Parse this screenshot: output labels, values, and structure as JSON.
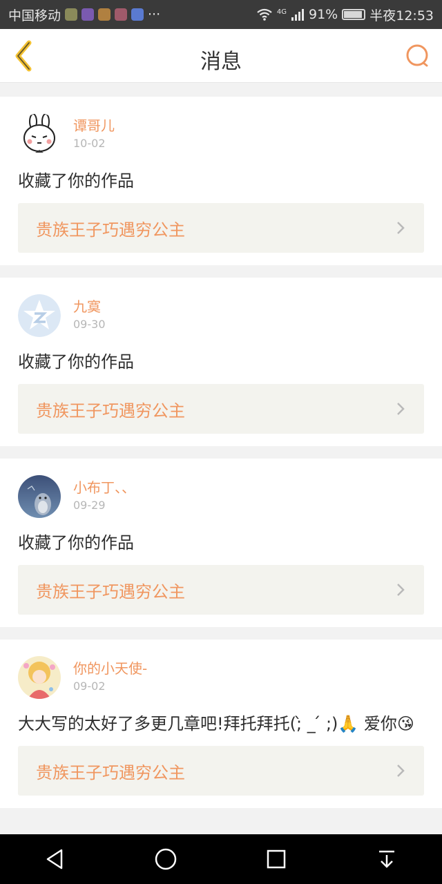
{
  "status_bar": {
    "carrier": "中国移动",
    "overflow": "···",
    "network": "4G",
    "battery": "91%",
    "battery_level": 0.91,
    "time": "半夜12:53"
  },
  "header": {
    "title": "消息",
    "back_icon": "back-chevron-icon",
    "search_icon": "search-icon"
  },
  "colors": {
    "accent": "#f0965f",
    "link_bg": "#f3f3ee",
    "page_bg": "#f2f2f2"
  },
  "messages": [
    {
      "username": "谭哥儿",
      "date": "10-02",
      "text": "收藏了你的作品",
      "work_title": "贵族王子巧遇穷公主"
    },
    {
      "username": "九寞",
      "date": "09-30",
      "text": "收藏了你的作品",
      "work_title": "贵族王子巧遇穷公主"
    },
    {
      "username": "小布丁、、",
      "date": "09-29",
      "text": "收藏了你的作品",
      "work_title": "贵族王子巧遇穷公主"
    },
    {
      "username": "你的小天使-",
      "date": "09-02",
      "text": "大大写的太好了多更几章吧!拜托拜托(;̀ _ ́ ;)🙏 爱你😘",
      "work_title": "贵族王子巧遇穷公主"
    }
  ],
  "nav_bar": {
    "back_icon": "nav-back-icon",
    "home_icon": "nav-home-icon",
    "recents_icon": "nav-recents-icon",
    "notifications_icon": "nav-pulldown-icon"
  }
}
